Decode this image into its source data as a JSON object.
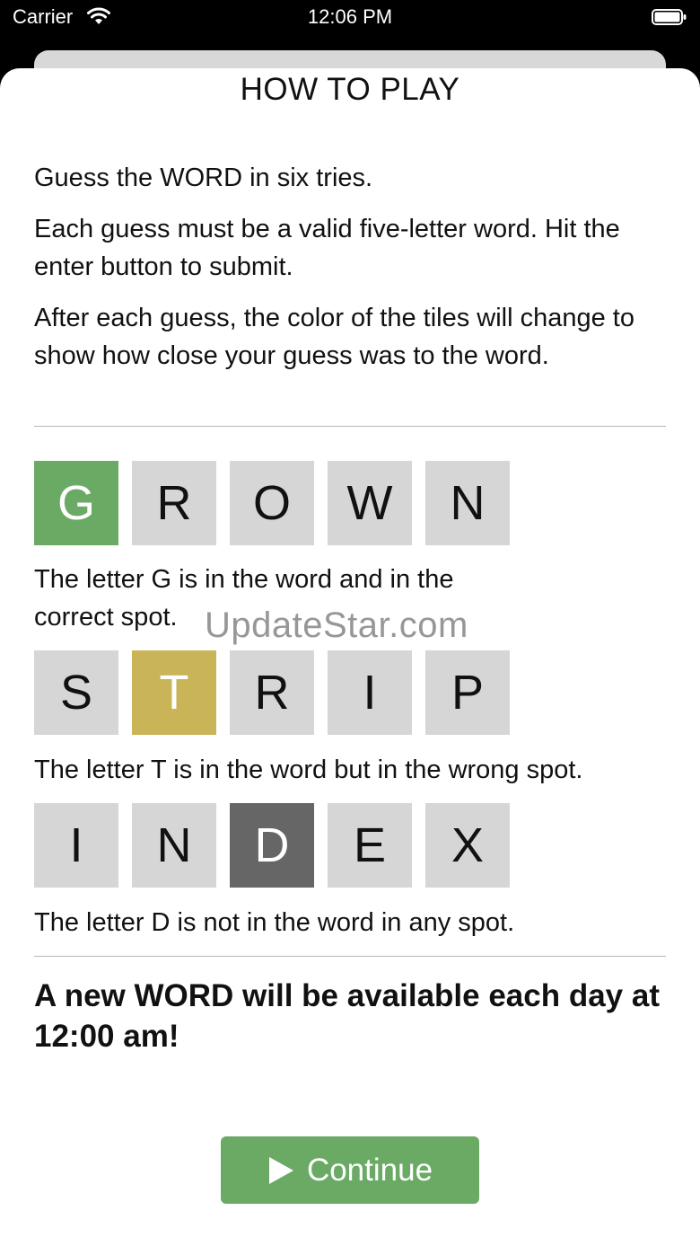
{
  "status_bar": {
    "carrier": "Carrier",
    "time": "12:06 PM",
    "wifi_icon": "wifi-icon",
    "battery_icon": "battery-icon"
  },
  "title": "HOW TO PLAY",
  "intro": [
    "Guess the WORD in six tries.",
    "Each guess must be a valid five-letter word. Hit the enter button to submit.",
    "After each guess, the color of the tiles will change to show how close your guess was to the word."
  ],
  "examples": [
    {
      "letters": [
        "G",
        "R",
        "O",
        "W",
        "N"
      ],
      "highlight_index": 0,
      "highlight_state": "correct",
      "caption": "The letter G is in the word and in the correct spot."
    },
    {
      "letters": [
        "S",
        "T",
        "R",
        "I",
        "P"
      ],
      "highlight_index": 1,
      "highlight_state": "present",
      "caption": "The letter T is in the word but in the wrong spot."
    },
    {
      "letters": [
        "I",
        "N",
        "D",
        "E",
        "X"
      ],
      "highlight_index": 2,
      "highlight_state": "absent",
      "caption": "The letter D is not in the word in any spot."
    }
  ],
  "watermark": "UpdateStar.com",
  "footer_note": "A new WORD will be available each day at 12:00 am!",
  "continue_button": {
    "label": "Continue",
    "icon": "play-icon"
  },
  "colors": {
    "correct": "#6aaa64",
    "present": "#c9b458",
    "absent": "#666666",
    "neutral_tile": "#d6d6d6",
    "button": "#6aaa64"
  }
}
